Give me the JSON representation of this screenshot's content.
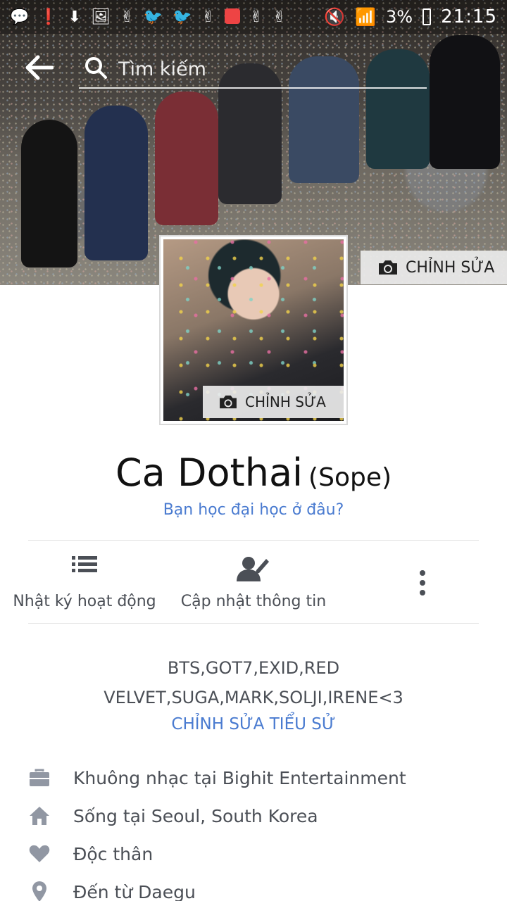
{
  "status_bar": {
    "icons": [
      "chat-bubble-icon",
      "alert-icon",
      "download-icon",
      "image-icon",
      "victory-hand-icon",
      "twitter-icon",
      "twitter-icon",
      "victory-hand-icon",
      "app-icon",
      "victory-hand-icon",
      "victory-hand-icon"
    ],
    "battery": "3%",
    "time": "21:15"
  },
  "nav": {
    "search_placeholder": "Tìm kiếm"
  },
  "cover": {
    "edit_label": "CHỈNH SỬA"
  },
  "avatar": {
    "edit_label": "CHỈNH SỬA"
  },
  "profile": {
    "name": "Ca Dothai",
    "alt_name": "(Sope)",
    "education_prompt": "Bạn học đại học ở đâu?"
  },
  "actions": {
    "activity_log": "Nhật ký hoạt động",
    "update_info": "Cập nhật thông tin"
  },
  "bio": {
    "line1": "BTS,GOT7,EXID,RED",
    "line2": "VELVET,SUGA,MARK,SOLJI,IRENE<3",
    "edit_label": "CHỈNH SỬA TIỂU SỬ"
  },
  "details": [
    {
      "icon": "briefcase-icon",
      "text": "Khuông nhạc tại Bighit Entertainment"
    },
    {
      "icon": "home-icon",
      "text": "Sống tại Seoul, South Korea"
    },
    {
      "icon": "heart-icon",
      "text": "Độc thân"
    },
    {
      "icon": "location-pin-icon",
      "text": "Đến từ Daegu"
    }
  ],
  "colors": {
    "link": "#4a7bd0",
    "icon_gray": "#9197a3",
    "text_gray": "#4b4f56"
  }
}
